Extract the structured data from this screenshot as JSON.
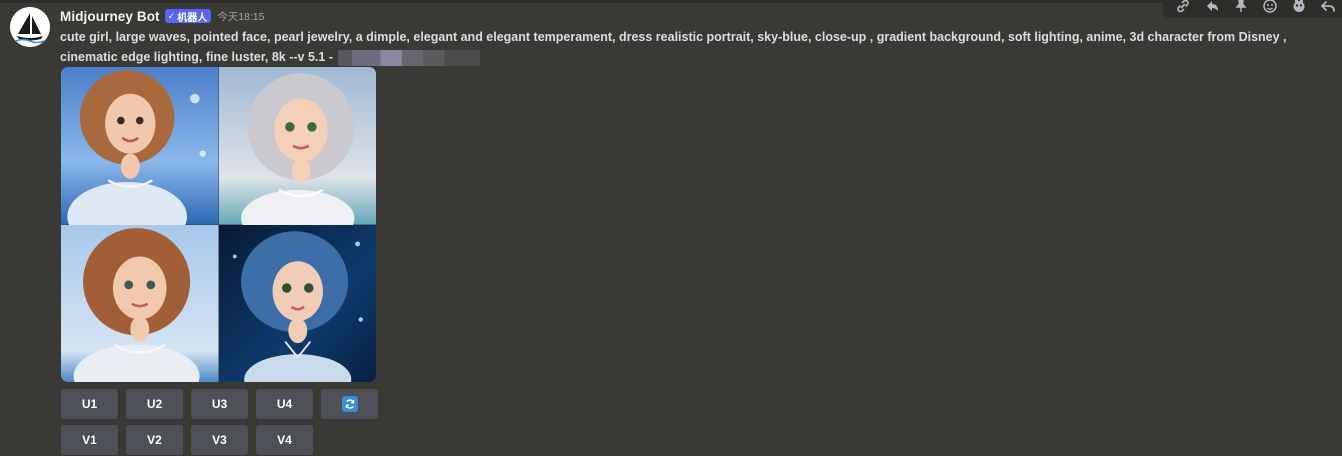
{
  "message": {
    "username": "Midjourney Bot",
    "bot_tag": "机器人",
    "bot_check": "✓",
    "timestamp": "今天18:15",
    "prompt": "cute girl, large waves, pointed face, pearl jewelry, a dimple, elegant and elegant temperament, dress realistic portrait, sky-blue, close-up , gradient background, soft lighting, anime, 3d character from Disney , cinematic edge lighting, fine luster, 8k --v 5.1 -"
  },
  "image_grid": {
    "tiles": [
      {
        "icon": "portrait-image-1",
        "hair_color": "#a8693d",
        "bg_color": "#6fa4dd"
      },
      {
        "icon": "portrait-image-2",
        "hair_color": "#c9c9cf",
        "bg_color": "#d0d6df"
      },
      {
        "icon": "portrait-image-3",
        "hair_color": "#a25e36",
        "bg_color": "#9dc4e8"
      },
      {
        "icon": "portrait-image-4",
        "hair_color": "#3d6ea7",
        "bg_color": "#0b2a52"
      }
    ]
  },
  "buttons": {
    "row1": [
      "U1",
      "U2",
      "U3",
      "U4"
    ],
    "row2": [
      "V1",
      "V2",
      "V3",
      "V4"
    ],
    "reroll_icon": "refresh-icon"
  },
  "toolbar_icons": [
    "link-icon",
    "reply-arrow-icon",
    "pin-icon",
    "add-reaction-icon",
    "apps-icon",
    "reply-icon"
  ],
  "colors": {
    "accent": "#5865f2",
    "button_bg": "#4e5058",
    "background": "#3b3935",
    "refresh": "#3b8fd9"
  }
}
